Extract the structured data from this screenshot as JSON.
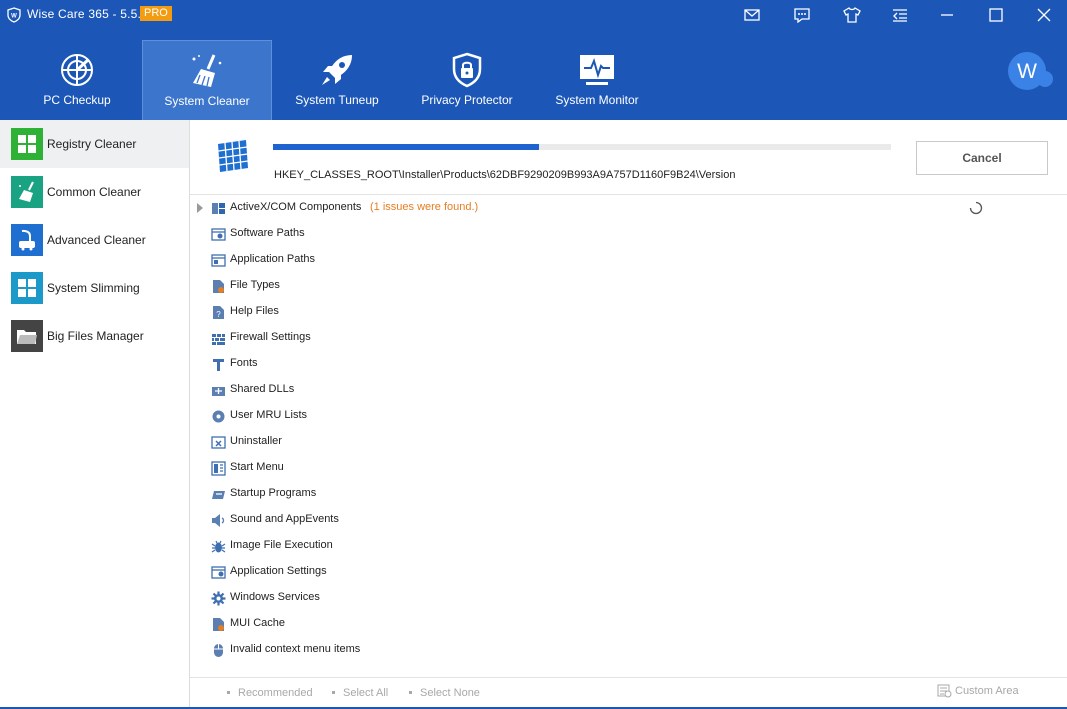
{
  "app": {
    "title": "Wise Care 365 - 5.5.5",
    "badge": "PRO",
    "avatar_letter": "W"
  },
  "titlebar_buttons": [
    "mail-icon",
    "feedback-icon",
    "skin-icon",
    "menu-icon",
    "minimize-icon",
    "maximize-icon",
    "close-icon"
  ],
  "nav": {
    "items": [
      {
        "label": "PC Checkup",
        "icon": "radar-icon"
      },
      {
        "label": "System Cleaner",
        "icon": "broom-icon",
        "active": true
      },
      {
        "label": "System Tuneup",
        "icon": "rocket-icon"
      },
      {
        "label": "Privacy Protector",
        "icon": "shield-lock-icon"
      },
      {
        "label": "System Monitor",
        "icon": "monitor-icon"
      }
    ]
  },
  "sidebar": {
    "items": [
      {
        "label": "Registry Cleaner",
        "icon": "registry-icon",
        "color": "#2fb135",
        "active": true
      },
      {
        "label": "Common Cleaner",
        "icon": "broom-icon",
        "color": "#1aa383"
      },
      {
        "label": "Advanced Cleaner",
        "icon": "vacuum-icon",
        "color": "#1e6fd0"
      },
      {
        "label": "System Slimming",
        "icon": "windows-icon",
        "color": "#1b9ac9"
      },
      {
        "label": "Big Files Manager",
        "icon": "folder-icon",
        "color": "#444444"
      }
    ]
  },
  "scan": {
    "progress": 0.43,
    "path": "HKEY_CLASSES_ROOT\\Installer\\Products\\62DBF9290209B993A9A757D1160F9B24\\Version",
    "cancel_label": "Cancel"
  },
  "categories": [
    {
      "label": "ActiveX/COM Components",
      "issues": "(1 issues were found.)",
      "icon": "activex-icon"
    },
    {
      "label": "Software Paths",
      "icon": "software-paths-icon"
    },
    {
      "label": "Application Paths",
      "icon": "application-paths-icon"
    },
    {
      "label": "File Types",
      "icon": "file-types-icon"
    },
    {
      "label": "Help Files",
      "icon": "help-files-icon"
    },
    {
      "label": "Firewall Settings",
      "icon": "firewall-icon"
    },
    {
      "label": "Fonts",
      "icon": "fonts-icon"
    },
    {
      "label": "Shared DLLs",
      "icon": "shared-dlls-icon"
    },
    {
      "label": "User MRU Lists",
      "icon": "mru-icon"
    },
    {
      "label": "Uninstaller",
      "icon": "uninstaller-icon"
    },
    {
      "label": "Start Menu",
      "icon": "start-menu-icon"
    },
    {
      "label": "Startup Programs",
      "icon": "startup-icon"
    },
    {
      "label": "Sound and AppEvents",
      "icon": "sound-icon"
    },
    {
      "label": "Image File Execution",
      "icon": "bug-icon"
    },
    {
      "label": "Application Settings",
      "icon": "app-settings-icon"
    },
    {
      "label": "Windows Services",
      "icon": "gear-icon"
    },
    {
      "label": "MUI Cache",
      "icon": "mui-cache-icon"
    },
    {
      "label": "Invalid context menu items",
      "icon": "mouse-icon"
    }
  ],
  "footer": {
    "recommended": "Recommended",
    "select_all": "Select All",
    "select_none": "Select None",
    "custom_area": "Custom Area"
  },
  "colors": {
    "brand_blue": "#1c57b8",
    "nav_active": "#3c75cc",
    "progress": "#1e63d0",
    "issue_orange": "#e67e22"
  }
}
